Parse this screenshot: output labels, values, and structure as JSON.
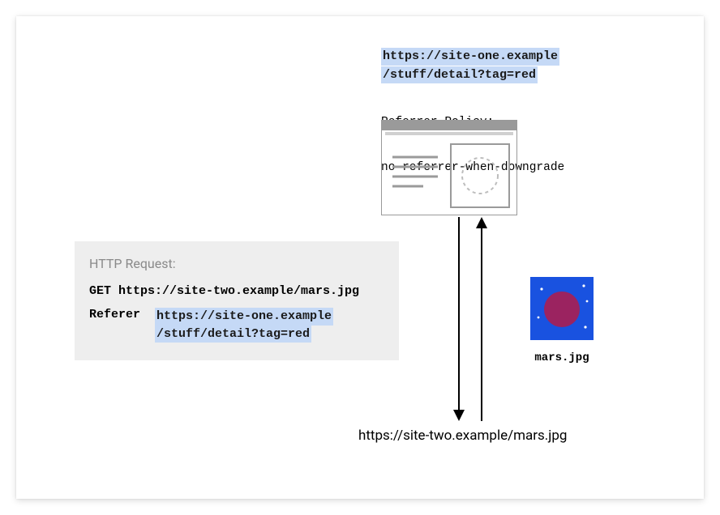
{
  "source_url_line1": "https://site-one.example",
  "source_url_line2": "/stuff/detail?tag=red",
  "policy_line1": "Referrer-Policy:",
  "policy_line2": "no-referrer-when-downgrade",
  "http": {
    "title": "HTTP Request:",
    "get_line": "GET https://site-two.example/mars.jpg",
    "referer_label": "Referer",
    "referer_url_line1": "https://site-one.example",
    "referer_url_line2": "/stuff/detail?tag=red"
  },
  "mars_label": "mars.jpg",
  "target_url": "https://site-two.example/mars.jpg",
  "colors": {
    "highlight": "#c5d9f6",
    "mars_bg": "#1952e0",
    "mars_planet": "#9b2360"
  }
}
